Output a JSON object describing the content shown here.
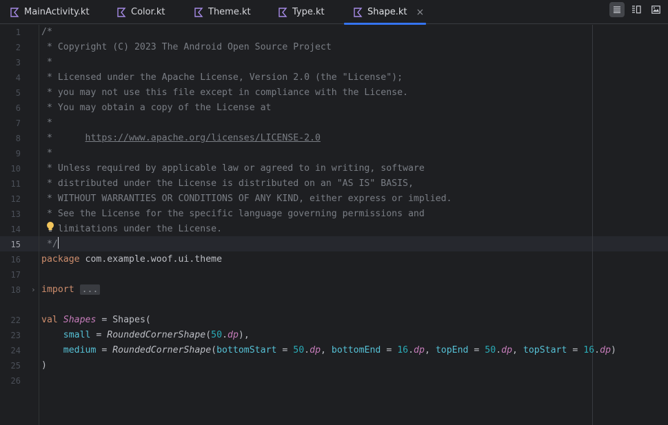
{
  "tabs": [
    {
      "label": "MainActivity.kt",
      "active": false
    },
    {
      "label": "Color.kt",
      "active": false
    },
    {
      "label": "Theme.kt",
      "active": false
    },
    {
      "label": "Type.kt",
      "active": false
    },
    {
      "label": "Shape.kt",
      "active": true
    }
  ],
  "tab_close_glyph": "×",
  "view_modes": [
    "code-view-icon",
    "split-view-icon",
    "design-view-icon"
  ],
  "colors": {
    "background": "#1e1f22",
    "accent": "#3574f0",
    "comment": "#7a7e85",
    "keyword": "#cf8e6d",
    "number": "#2aacb8",
    "named_arg": "#56c1d6",
    "property": "#c77dbb"
  },
  "editor": {
    "current_line": 15,
    "lines": [
      {
        "n": "1"
      },
      {
        "n": "2"
      },
      {
        "n": "3"
      },
      {
        "n": "4"
      },
      {
        "n": "5"
      },
      {
        "n": "6"
      },
      {
        "n": "7"
      },
      {
        "n": "8"
      },
      {
        "n": "9"
      },
      {
        "n": "10"
      },
      {
        "n": "11"
      },
      {
        "n": "12"
      },
      {
        "n": "13"
      },
      {
        "n": "14"
      },
      {
        "n": "15"
      },
      {
        "n": "16"
      },
      {
        "n": "17"
      },
      {
        "n": "18"
      },
      {
        "n": "22"
      },
      {
        "n": "23"
      },
      {
        "n": "24"
      },
      {
        "n": "25"
      },
      {
        "n": "26"
      }
    ],
    "text": {
      "l1": "/*",
      "l2": " * Copyright (C) 2023 The Android Open Source Project",
      "l3": " *",
      "l4": " * Licensed under the Apache License, Version 2.0 (the \"License\");",
      "l5": " * you may not use this file except in compliance with the License.",
      "l6": " * You may obtain a copy of the License at",
      "l7": " *",
      "l8_prefix": " *      ",
      "l8_link": "https://www.apache.org/licenses/LICENSE-2.0",
      "l9": " *",
      "l10": " * Unless required by applicable law or agreed to in writing, software",
      "l11": " * distributed under the License is distributed on an \"AS IS\" BASIS,",
      "l12": " * WITHOUT WARRANTIES OR CONDITIONS OF ANY KIND, either express or implied.",
      "l13": " * See the License for the specific language governing permissions and",
      "l14": " * limitations under the License.",
      "l15": " */",
      "l16_kw": "package",
      "l16_rest": " com.example.woof.ui.theme",
      "l18_kw": "import",
      "l18_fold": "...",
      "l22_kw": "val",
      "l22_name": "Shapes",
      "l22_rest": " = Shapes(",
      "l23_indent": "    ",
      "l23_arg": "small",
      "l23_eq": " = ",
      "l23_fn": "RoundedCornerShape",
      "l23_open": "(",
      "l23_num": "50",
      "l23_dot": ".",
      "l23_ext": "dp",
      "l23_close": "),",
      "l24_indent": "    ",
      "l24_arg": "medium",
      "l24_eq": " = ",
      "l24_fn": "RoundedCornerShape",
      "l24_open": "(",
      "l24_a1": "bottomStart",
      "l24_a1eq": " = ",
      "l24_n1": "50",
      "l24_d1": ".",
      "l24_e1": "dp",
      "l24_c1": ", ",
      "l24_a2": "bottomEnd",
      "l24_a2eq": " = ",
      "l24_n2": "16",
      "l24_d2": ".",
      "l24_e2": "dp",
      "l24_c2": ", ",
      "l24_a3": "topEnd",
      "l24_a3eq": " = ",
      "l24_n3": "50",
      "l24_d3": ".",
      "l24_e3": "dp",
      "l24_c3": ", ",
      "l24_a4": "topStart",
      "l24_a4eq": " = ",
      "l24_n4": "16",
      "l24_d4": ".",
      "l24_e4": "dp",
      "l24_close": ")",
      "l25": ")"
    }
  }
}
